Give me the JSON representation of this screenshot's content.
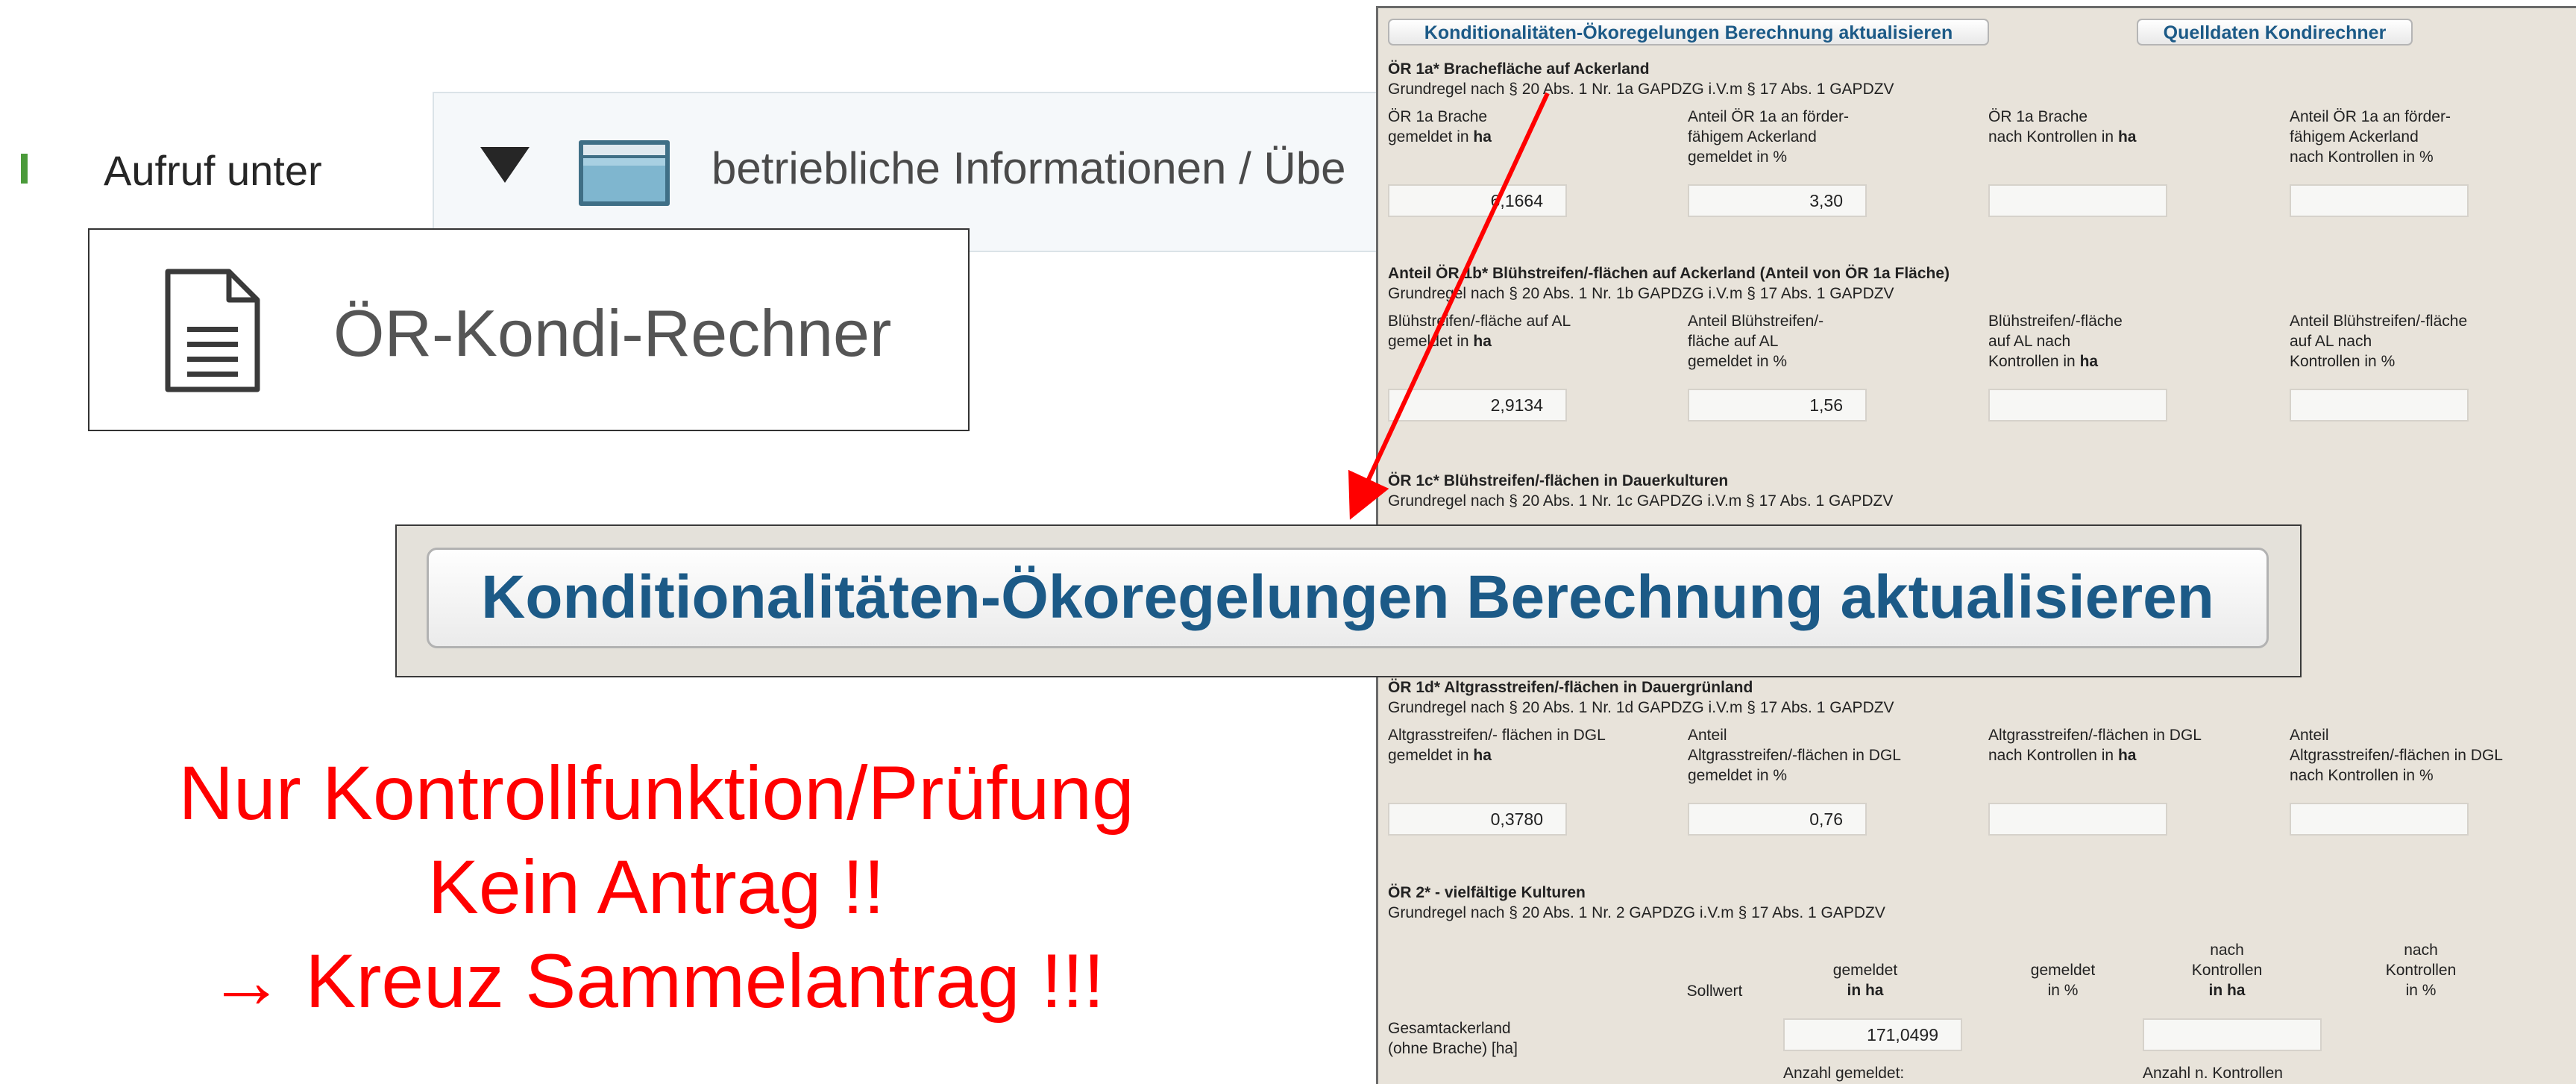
{
  "slide": {
    "bullet_text": "Aufruf unter",
    "navbar_text": "betriebliche Informationen / Übe",
    "menu_item": "ÖR-Kondi-Rechner",
    "note_lines": [
      "Nur Kontrollfunktion/Prüfung",
      "Kein Antrag !!",
      "→ Kreuz Sammelantrag !!!"
    ],
    "note_color": "#ff0000",
    "accent_color": "#4a9a3a"
  },
  "icons": {
    "nav_expand": "triangle-down-icon",
    "nav_folder": "folder-icon",
    "menu_doc": "document-icon",
    "pointer": "red-arrow"
  },
  "zoom": {
    "button_label": "Konditionalitäten-Ökoregelungen Berechnung aktualisieren"
  },
  "panel": {
    "buttons": {
      "update": "Konditionalitäten-Ökoregelungen Berechnung aktualisieren",
      "source": "Quelldaten Kondirechner"
    },
    "s1": {
      "title": "ÖR 1a* Brachefläche auf Ackerland",
      "sub": "Grundregel nach § 20 Abs. 1 Nr. 1a GAPDZG i.V.m § 17 Abs. 1 GAPDZV",
      "c1": [
        "ÖR 1a Brache",
        "gemeldet in ",
        "ha"
      ],
      "c2": [
        "Anteil ÖR 1a an förder-",
        "fähigem Ackerland",
        "gemeldet in %"
      ],
      "c3": [
        "ÖR 1a Brache",
        "nach Kontrollen in ",
        "ha"
      ],
      "c4": [
        "Anteil ÖR 1a an förder-",
        "fähigem Ackerland",
        "nach Kontrollen in %"
      ],
      "v1": "6,1664",
      "v2": "3,30"
    },
    "s2": {
      "title": "Anteil ÖR 1b* Blühstreifen/-flächen auf Ackerland (Anteil von ÖR 1a Fläche)",
      "sub": "Grundregel nach § 20 Abs. 1 Nr. 1b GAPDZG i.V.m § 17 Abs. 1 GAPDZV",
      "c1": [
        "Blühstreifen/-fläche auf AL",
        "gemeldet in ",
        "ha"
      ],
      "c2": [
        "Anteil Blühstreifen/-",
        "fläche auf AL",
        "gemeldet in %"
      ],
      "c3": [
        "Blühstreifen/-fläche",
        "auf AL nach",
        "Kontrollen in ",
        "ha"
      ],
      "c4": [
        "Anteil Blühstreifen/-fläche",
        "auf AL nach",
        "Kontrollen in %"
      ],
      "v1": "2,9134",
      "v2": "1,56"
    },
    "s3": {
      "title": "ÖR 1c* Blühstreifen/-flächen in Dauerkulturen",
      "sub": "Grundregel nach § 20 Abs. 1 Nr. 1c GAPDZG i.V.m § 17 Abs. 1 GAPDZV"
    },
    "s4": {
      "title": "ÖR 1d* Altgrasstreifen/-flächen in Dauergrünland",
      "sub": "Grundregel nach § 20 Abs. 1 Nr. 1d GAPDZG i.V.m § 17 Abs. 1 GAPDZV",
      "c1": [
        "Altgrasstreifen/- flächen in DGL",
        "gemeldet in ",
        "ha"
      ],
      "c2": [
        "Anteil",
        "Altgrasstreifen/-flächen in DGL",
        "gemeldet in %"
      ],
      "c3": [
        "Altgrasstreifen/-flächen in DGL",
        "nach Kontrollen in ",
        "ha"
      ],
      "c4": [
        "Anteil",
        "Altgrasstreifen/-flächen in DGL",
        "nach Kontrollen in %"
      ],
      "v1": "0,3780",
      "v2": "0,76"
    },
    "s5": {
      "title": "ÖR 2* - vielfältige Kulturen",
      "sub": "Grundregel nach § 20 Abs. 1 Nr. 2 GAPDZG i.V.m § 17 Abs. 1 GAPDZV",
      "headers": {
        "soll": "Sollwert",
        "gem_ha_1": "gemeldet",
        "gem_ha_2": "in ha",
        "gem_pct_1": "gemeldet",
        "gem_pct_2": "in %",
        "nk_ha_1": "nach",
        "nk_ha_2": "Kontrollen",
        "nk_ha_3": "in ha",
        "nk_pct_1": "nach",
        "nk_pct_2": "Kontrollen",
        "nk_pct_3": "in %"
      },
      "row_label_1": "Gesamtackerland",
      "row_label_2": "(ohne Brache) [ha]",
      "row_value": "171,0499",
      "anzahl_gemeldet": "Anzahl gemeldet:",
      "anzahl_kontrollen": "Anzahl n. Kontrollen"
    }
  }
}
